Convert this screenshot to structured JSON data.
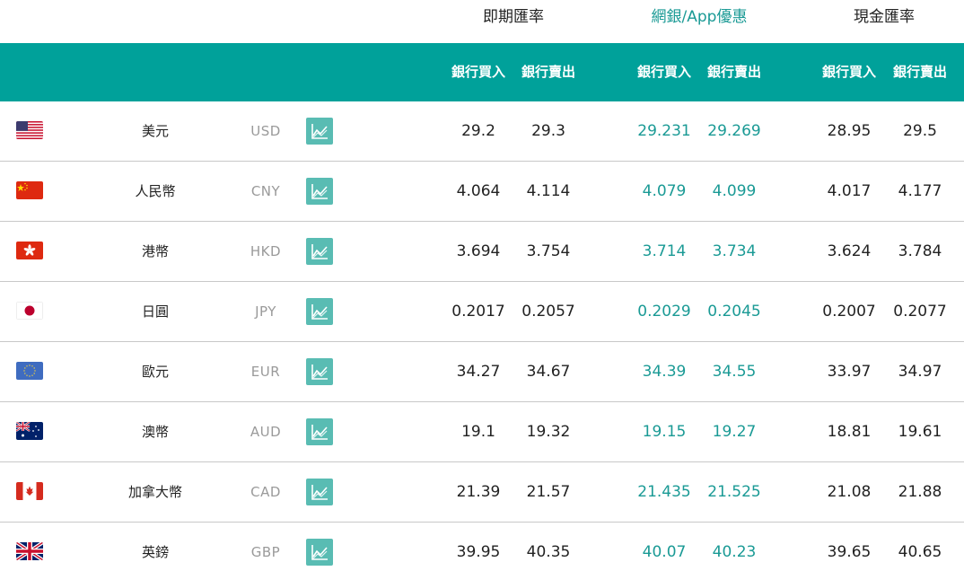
{
  "header": {
    "spot_rate": "即期匯率",
    "app_rate": "網銀/App優惠",
    "cash_rate": "現金匯率",
    "buy": "銀行買入",
    "sell": "銀行賣出"
  },
  "colors": {
    "accent": "#00a19a",
    "accent_text": "#1a9a95",
    "chart_button": "#59bcb3"
  },
  "currencies": [
    {
      "name": "美元",
      "code": "USD",
      "flag": "us-flag-icon",
      "spot_buy": "29.2",
      "spot_sell": "29.3",
      "app_buy": "29.231",
      "app_sell": "29.269",
      "cash_buy": "28.95",
      "cash_sell": "29.5"
    },
    {
      "name": "人民幣",
      "code": "CNY",
      "flag": "cn-flag-icon",
      "spot_buy": "4.064",
      "spot_sell": "4.114",
      "app_buy": "4.079",
      "app_sell": "4.099",
      "cash_buy": "4.017",
      "cash_sell": "4.177"
    },
    {
      "name": "港幣",
      "code": "HKD",
      "flag": "hk-flag-icon",
      "spot_buy": "3.694",
      "spot_sell": "3.754",
      "app_buy": "3.714",
      "app_sell": "3.734",
      "cash_buy": "3.624",
      "cash_sell": "3.784"
    },
    {
      "name": "日圓",
      "code": "JPY",
      "flag": "jp-flag-icon",
      "spot_buy": "0.2017",
      "spot_sell": "0.2057",
      "app_buy": "0.2029",
      "app_sell": "0.2045",
      "cash_buy": "0.2007",
      "cash_sell": "0.2077"
    },
    {
      "name": "歐元",
      "code": "EUR",
      "flag": "eu-flag-icon",
      "spot_buy": "34.27",
      "spot_sell": "34.67",
      "app_buy": "34.39",
      "app_sell": "34.55",
      "cash_buy": "33.97",
      "cash_sell": "34.97"
    },
    {
      "name": "澳幣",
      "code": "AUD",
      "flag": "au-flag-icon",
      "spot_buy": "19.1",
      "spot_sell": "19.32",
      "app_buy": "19.15",
      "app_sell": "19.27",
      "cash_buy": "18.81",
      "cash_sell": "19.61"
    },
    {
      "name": "加拿大幣",
      "code": "CAD",
      "flag": "ca-flag-icon",
      "spot_buy": "21.39",
      "spot_sell": "21.57",
      "app_buy": "21.435",
      "app_sell": "21.525",
      "cash_buy": "21.08",
      "cash_sell": "21.88"
    },
    {
      "name": "英鎊",
      "code": "GBP",
      "flag": "gb-flag-icon",
      "spot_buy": "39.95",
      "spot_sell": "40.35",
      "app_buy": "40.07",
      "app_sell": "40.23",
      "cash_buy": "39.65",
      "cash_sell": "40.65"
    }
  ]
}
